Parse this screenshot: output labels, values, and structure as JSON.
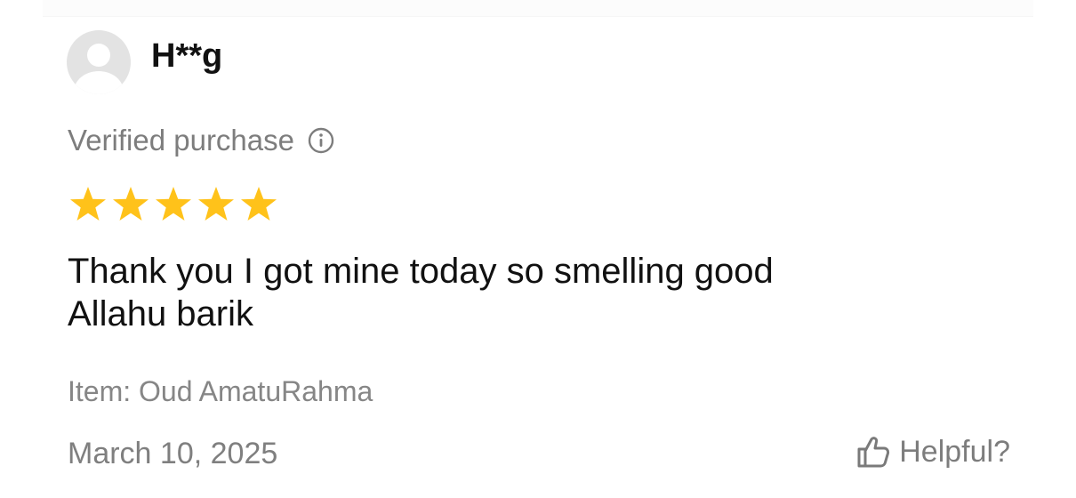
{
  "review": {
    "reviewer": {
      "name": "H**g",
      "avatar_icon": "user-avatar-icon"
    },
    "verified": {
      "label": "Verified purchase",
      "icon": "info-icon"
    },
    "rating": {
      "value": 5,
      "max": 5,
      "star_color": "#ffc21a"
    },
    "text": "Thank you I got mine today so smelling good\nAllahu barik",
    "item_label": "Item: Oud AmatuRahma",
    "date": "March 10, 2025",
    "helpful": {
      "label": "Helpful?",
      "icon": "thumbs-up-icon"
    }
  },
  "colors": {
    "text_primary": "#111111",
    "text_secondary": "#7d7d7d",
    "star": "#ffc21a",
    "avatar_bg": "#e3e3e3"
  }
}
